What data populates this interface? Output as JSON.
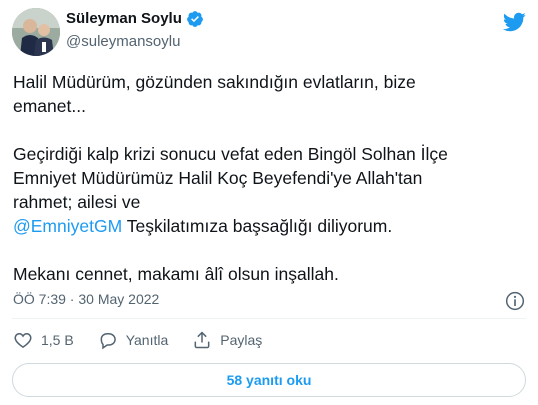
{
  "author": {
    "display_name": "Süleyman Soylu",
    "handle": "@suleymansoylu"
  },
  "tweet": {
    "line1": "Halil Müdürüm, gözünden sakındığın evlatların, bize",
    "line2": "emanet...",
    "line3": "Geçirdiği kalp krizi sonucu vefat eden Bingöl Solhan İlçe",
    "line4": "Emniyet Müdürümüz Halil Koç Beyefendi'ye Allah'tan",
    "line5": "rahmet; ailesi ve",
    "mention": "@EmniyetGM",
    "line6_rest": " Teşkilatımıza başsağlığı diliyorum.",
    "line7": "Mekanı cennet, makamı âlî olsun inşallah."
  },
  "meta": {
    "timestamp": "ÖÖ 7:39 · 30 May 2022"
  },
  "actions": {
    "like_count": "1,5 B",
    "reply_label": "Yanıtla",
    "share_label": "Paylaş"
  },
  "replies_button": {
    "label": "58 yanıtı oku"
  },
  "colors": {
    "accent": "#1d9bf0",
    "like_red": "#f91880",
    "text": "#0f1419",
    "muted": "#536471"
  },
  "icons": [
    "verified-badge-icon",
    "twitter-bird-icon",
    "info-icon",
    "heart-icon",
    "reply-bubble-icon",
    "share-icon"
  ]
}
